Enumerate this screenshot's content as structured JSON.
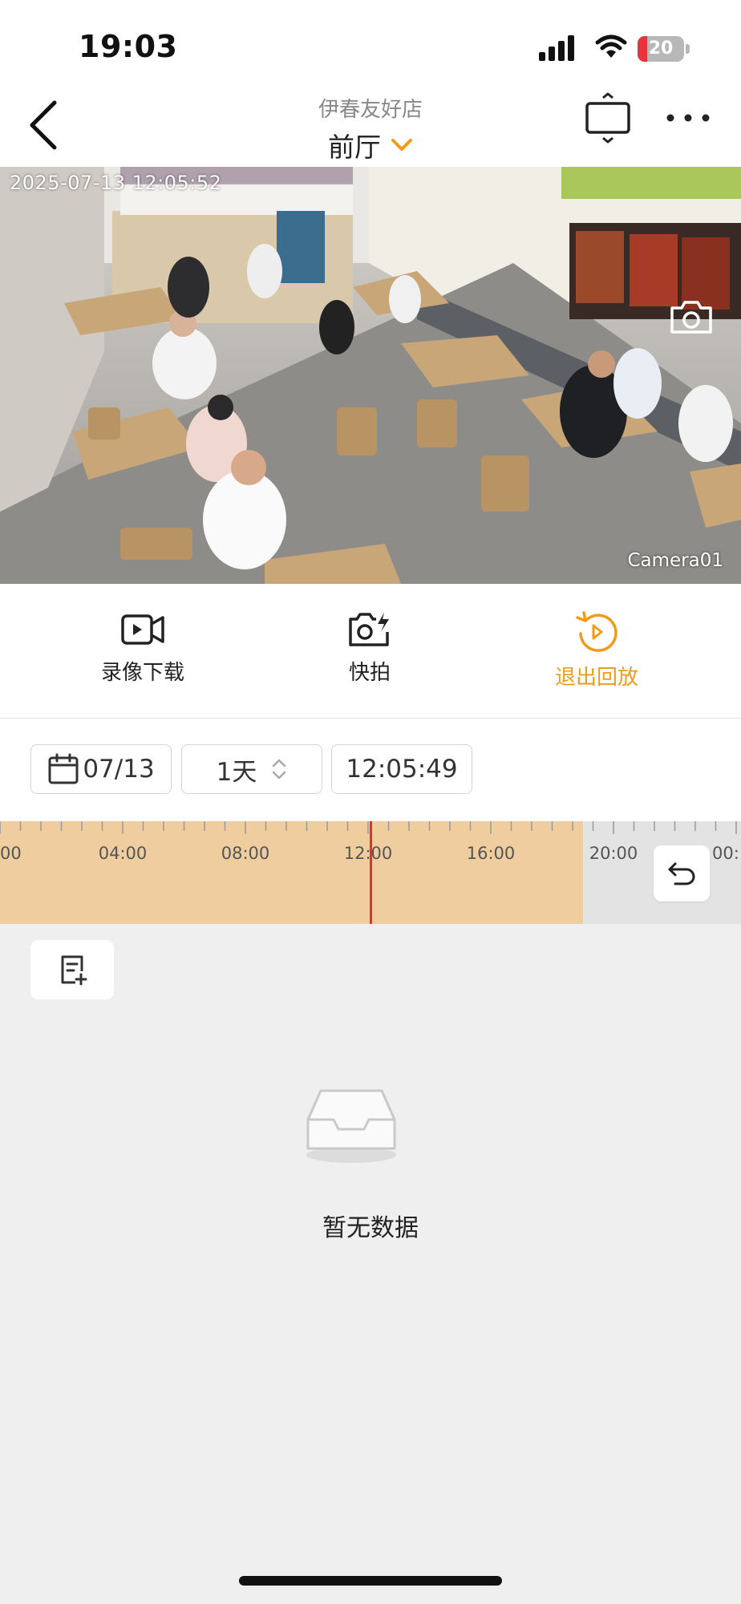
{
  "status_bar": {
    "time": "19:03",
    "battery": "20",
    "battery_level": 0.2,
    "battery_color": "#e8323c"
  },
  "nav": {
    "store_name": "伊春友好店",
    "camera_name": "前厅",
    "accent_color": "#f09b1a"
  },
  "video": {
    "timestamp": "2025-07-13 12:05:52",
    "camera_label": "Camera01"
  },
  "actions": [
    {
      "icon": "video-camera-icon",
      "label": "录像下载"
    },
    {
      "icon": "flash-snapshot-icon",
      "label": "快拍"
    },
    {
      "icon": "replay-icon",
      "label": "退出回放",
      "color": "#f09b1a"
    }
  ],
  "filters": {
    "date": "07/13",
    "range": "1天",
    "time": "12:05:49"
  },
  "timeline": {
    "tick_labels": [
      "00",
      "04:00",
      "08:00",
      "12:00",
      "16:00",
      "20:00",
      "00:"
    ],
    "recorded_color": "#efcd9e",
    "recorded_until_hour": 19.0,
    "playhead_time": "12:05",
    "playhead_color": "#e53030"
  },
  "empty_state": {
    "text": "暂无数据"
  }
}
